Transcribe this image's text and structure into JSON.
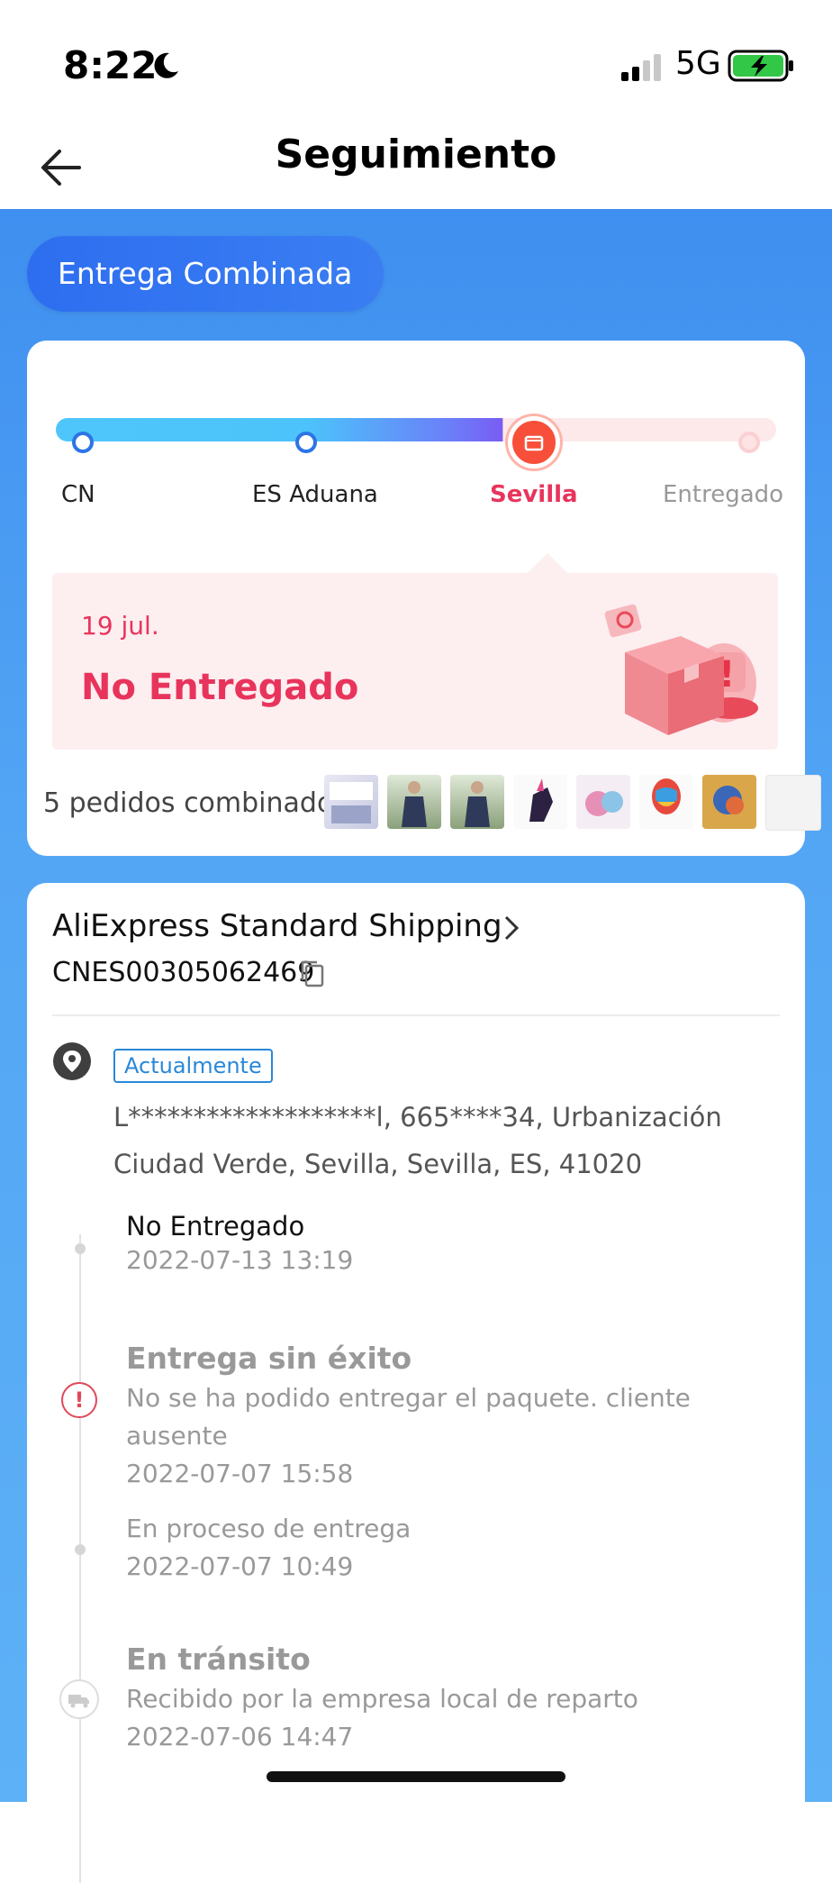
{
  "status_bar": {
    "time": "8:22",
    "network": "5G"
  },
  "header": {
    "title": "Seguimiento"
  },
  "combined": {
    "label": "Entrega Combinada"
  },
  "progress": {
    "stages": [
      "CN",
      "ES Aduana",
      "Sevilla",
      "Entregado"
    ],
    "current_stage": "Sevilla"
  },
  "status": {
    "date": "19 jul.",
    "text": "No Entregado"
  },
  "orders": {
    "summary": "5 pedidos combinados"
  },
  "shipping": {
    "carrier": "AliExpress Standard Shipping",
    "tracking_number": "CNES00305062469",
    "badge": "Actualmente",
    "address": "L*******************l,  665****34,  Urbanización Ciudad Verde,  Sevilla,  Sevilla,  ES,  41020"
  },
  "timeline": [
    {
      "title": "No Entregado",
      "date": "2022-07-13 13:19"
    },
    {
      "title": "Entrega sin éxito",
      "description": "No se ha podido entregar el paquete. cliente ausente",
      "date": "2022-07-07 15:58"
    },
    {
      "title": "En proceso de entrega",
      "date": "2022-07-07 10:49"
    },
    {
      "title": "En tránsito",
      "description": "Recibido por la empresa local de reparto",
      "date": "2022-07-06 14:47"
    }
  ],
  "colors": {
    "accent_blue": "#3f8ff0",
    "alert_pink": "#e8345c",
    "current_marker": "#f84f3a"
  }
}
